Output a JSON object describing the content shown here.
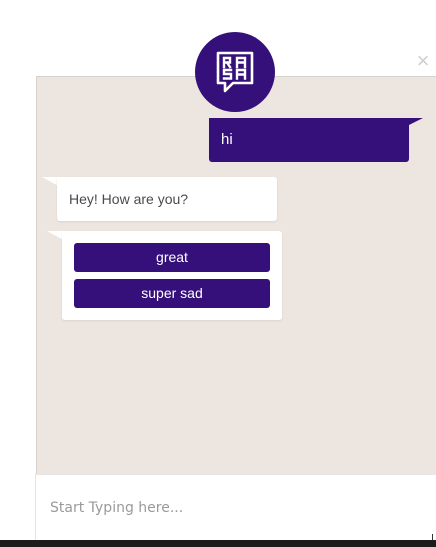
{
  "close_glyph": "×",
  "logo": {
    "icon": "rasa-logo-icon",
    "letters": "RASA",
    "bg_color": "#35107a"
  },
  "messages": [
    {
      "sender": "user",
      "text": "hi"
    },
    {
      "sender": "bot",
      "text": "Hey! How are you?"
    }
  ],
  "quick_replies": [
    {
      "label": "great"
    },
    {
      "label": "super sad"
    }
  ],
  "input": {
    "placeholder": "Start Typing here...",
    "value": ""
  },
  "colors": {
    "accent": "#35107a",
    "chat_bg": "#ede5df",
    "bubble": "#ffffff"
  }
}
